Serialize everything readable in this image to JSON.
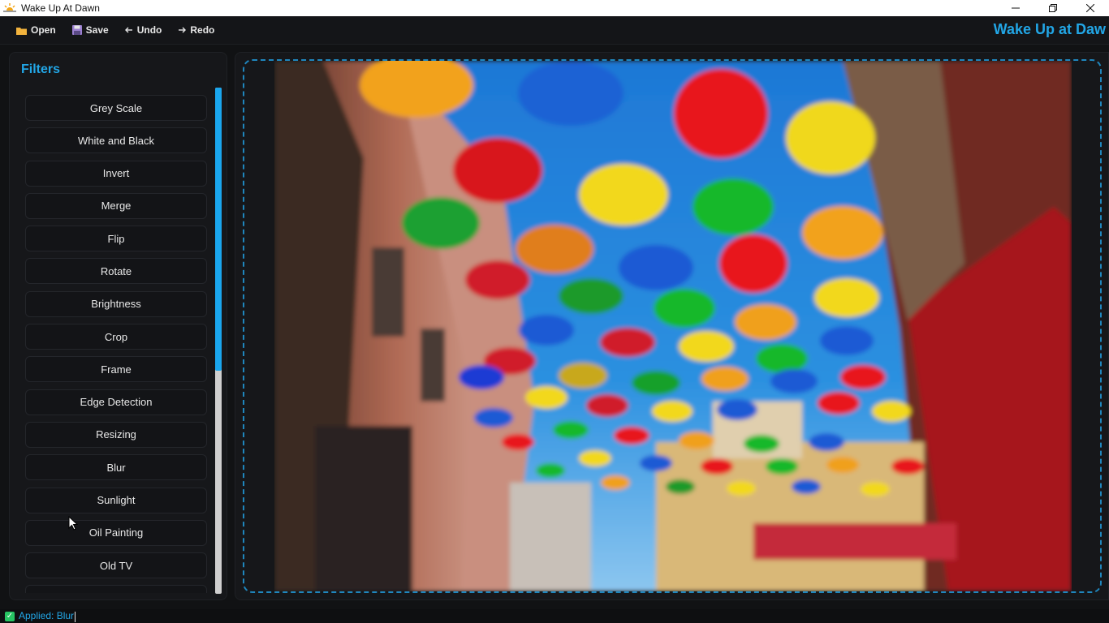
{
  "window": {
    "title": "Wake Up At Dawn",
    "controls": [
      "minimize-icon",
      "restore-icon",
      "close-icon"
    ]
  },
  "toolbar": {
    "open_label": "Open",
    "save_label": "Save",
    "undo_label": "Undo",
    "redo_label": "Redo",
    "brand": "Wake Up at Daw"
  },
  "sidebar": {
    "title": "Filters",
    "filters": [
      "Grey Scale",
      "White and Black",
      "Invert",
      "Merge",
      "Flip",
      "Rotate",
      "Brightness",
      "Crop",
      "Frame",
      "Edge Detection",
      "Resizing",
      "Blur",
      "Sunlight",
      "Oil Painting",
      "Old TV"
    ],
    "scroll_position": 0.56
  },
  "status": {
    "text": "Applied: Blur",
    "icon": "checkbox-checked-icon"
  },
  "colors": {
    "accent": "#22a6e6",
    "background": "#111214",
    "panel": "#16171a",
    "status_ok": "#27c463"
  }
}
